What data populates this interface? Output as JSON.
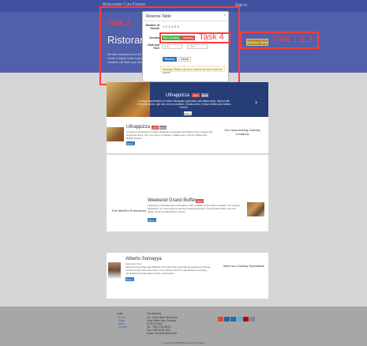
{
  "navbar": {
    "brand": "Ristorante Con Fusion",
    "link": "Sign in"
  },
  "hero": {
    "title_line1": "Ristorante",
    "title_line2": "Ristorante",
    "text": "We take inspiration from the World's best cuisines, and create a unique fusion experience. Our lipsmacking creations will tickle your culinary senses!",
    "reserve_button": "Reserve Table"
  },
  "annotations": {
    "task2": "Task 2",
    "task4": "Task 4",
    "task13": "Task 1 & 3",
    "color": "#ff3b3b"
  },
  "modal": {
    "title": "Reserve Table",
    "close": "×",
    "number_label": "Number of Guests",
    "guest_options": "1 2 3 4 5 6",
    "section_label": "Section",
    "non_smoking": "Non-Smoking",
    "smoking": "Smoking",
    "date_label": "Date and Time",
    "date_placeholder": "Date",
    "time_placeholder": "Time",
    "reserve": "Reserve",
    "cancel": "Cancel",
    "warning": "Warning: Please call us to reserve for more than six guests"
  },
  "carousel": {
    "title": "Uthappizza",
    "badge_hot": "HOT",
    "badge_price": "$4.99",
    "desc": "A unique combination of Indian Uthappam (pancake) and Italian pizza, topped with Cerignola olives, ripe vine cherry tomatoes, Vidalia onion, Guntur chillies and Buffalo Paneer.",
    "more": "More »"
  },
  "card1": {
    "title": "Uthappizza",
    "badge_hot": "HOT",
    "badge_price": "$4.99",
    "desc": "A unique combination of Indian Uthappam (pancake) and Italian pizza, topped with Cerignola olives, ripe vine cherry tomatoes, Vidalia onion, Guntur chillies and Buffalo Paneer.",
    "more": "More »",
    "side": "Our Lipsmacking Culinary Creations"
  },
  "card2": {
    "title": "Weekend Grand Buffet",
    "badge_new": "NEW",
    "desc": "Featuring mouthwatering combinations with a choice of five different salads, six enticing appetizers, six main entrees and five choicest desserts. Free flowing bubbly and soft drinks. All for just $19.99 per person",
    "more": "More »",
    "side": "This Month's Promotions"
  },
  "card3": {
    "title": "Alberto Somayya",
    "role": "Executive Chef",
    "desc": "Award winning three-star Michelin chef with wide International experience having worked closely with whos-who in the culinary world, he specializes in creating mouthwatering Indo-Italian fusion experiences.",
    "more": "More »",
    "side": "Meet our Culinary Specialists"
  },
  "footer": {
    "links_head": "Links",
    "links": [
      "Home",
      "About",
      "Menu",
      "Contact"
    ],
    "address_head": "Our Address",
    "address": [
      "121, Clear Water Bay Road",
      "Clear Water Bay, Kowloon",
      "HONG KONG",
      "Tel.: +852 1234 5678",
      "Fax: +852 8765 4321",
      "Email: confusion@food.net"
    ],
    "copyright": "© Copyright 2015 Ristorante Con Fusion",
    "social_colors": [
      "#dd4b39",
      "#3b5998",
      "#0e76a8",
      "#55acee",
      "#bb0000",
      "#888888"
    ]
  }
}
